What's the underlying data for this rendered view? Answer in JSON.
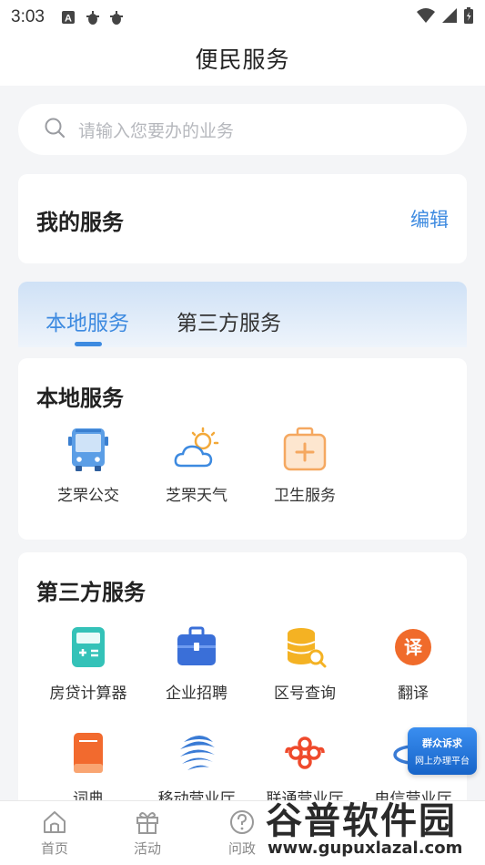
{
  "status_bar": {
    "time": "3:03"
  },
  "header": {
    "title": "便民服务"
  },
  "search": {
    "placeholder": "请输入您要办的业务"
  },
  "my_services": {
    "title": "我的服务",
    "edit_label": "编辑"
  },
  "tabs": [
    {
      "label": "本地服务",
      "active": true
    },
    {
      "label": "第三方服务",
      "active": false
    }
  ],
  "local_services": {
    "title": "本地服务",
    "items": [
      {
        "label": "芝罘公交",
        "icon": "bus-icon"
      },
      {
        "label": "芝罘天气",
        "icon": "weather-icon"
      },
      {
        "label": "卫生服务",
        "icon": "medical-kit-icon"
      }
    ]
  },
  "third_party_services": {
    "title": "第三方服务",
    "items": [
      {
        "label": "房贷计算器",
        "icon": "calculator-icon"
      },
      {
        "label": "企业招聘",
        "icon": "briefcase-icon"
      },
      {
        "label": "区号查询",
        "icon": "database-search-icon"
      },
      {
        "label": "翻译",
        "icon": "translate-icon"
      },
      {
        "label": "词典",
        "icon": "book-icon"
      },
      {
        "label": "移动营业厅",
        "icon": "china-mobile-icon"
      },
      {
        "label": "联通营业厅",
        "icon": "china-unicom-icon"
      },
      {
        "label": "电信营业厅",
        "icon": "china-telecom-icon"
      }
    ]
  },
  "floating_badge": {
    "line1": "群众诉求",
    "line2": "网上办理平台"
  },
  "bottom_nav": [
    {
      "label": "首页",
      "icon": "home-icon"
    },
    {
      "label": "活动",
      "icon": "gift-icon"
    },
    {
      "label": "问政",
      "icon": "question-icon"
    }
  ],
  "watermark": {
    "title": "谷普软件园",
    "url": "www.gupuxlazal.com"
  },
  "colors": {
    "accent": "#3d8ae0",
    "background": "#f4f5f7"
  }
}
